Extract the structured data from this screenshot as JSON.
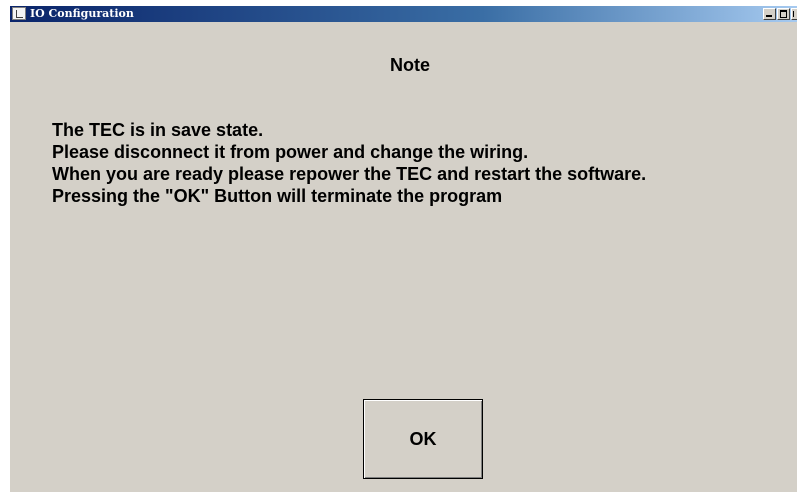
{
  "window": {
    "title": "IO Configuration"
  },
  "dialog": {
    "heading": "Note",
    "message_lines": [
      "The TEC is in save state.",
      "Please disconnect it from power and change the wiring.",
      "When you are ready please repower the TEC and restart the software.",
      "Pressing the \"OK\" Button will terminate the program"
    ],
    "ok_label": "OK"
  },
  "icons": {
    "app": "app-icon",
    "minimize": "minimize-icon",
    "maximize": "maximize-icon",
    "close": "close-icon"
  },
  "colors": {
    "window_bg": "#d4d0c8",
    "titlebar_start": "#0a246a",
    "titlebar_end": "#a6caf0",
    "text": "#000000"
  }
}
